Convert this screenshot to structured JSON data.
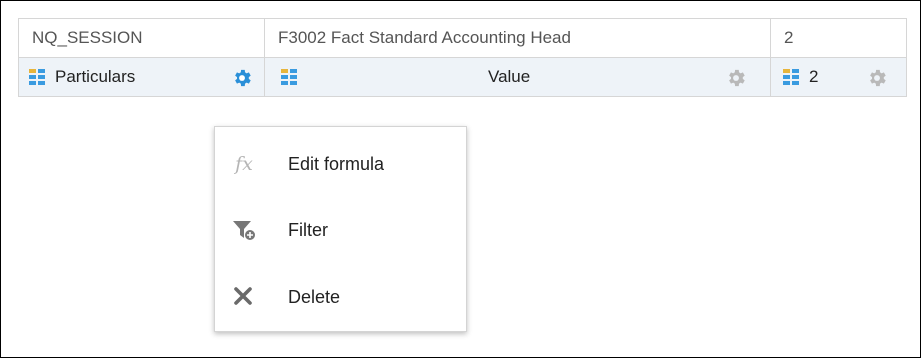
{
  "columns": [
    {
      "header": "NQ_SESSION",
      "subheader": "Particulars"
    },
    {
      "header": "F3002 Fact Standard Accounting Head",
      "subheader": "Value"
    },
    {
      "header": "2",
      "subheader": "2"
    }
  ],
  "context_menu": {
    "items": [
      {
        "label": "Edit formula",
        "icon": "fx-icon"
      },
      {
        "label": "Filter",
        "icon": "filter-icon"
      },
      {
        "label": "Delete",
        "icon": "delete-icon"
      }
    ],
    "fx_glyph": "fx"
  },
  "colors": {
    "gear_active": "#2a8fd8",
    "gear_inactive": "#b9b9b9",
    "grid_icon_blue": "#3a9be0",
    "grid_icon_yellow": "#e7b53c",
    "subheader_bg": "#eef3f8"
  }
}
